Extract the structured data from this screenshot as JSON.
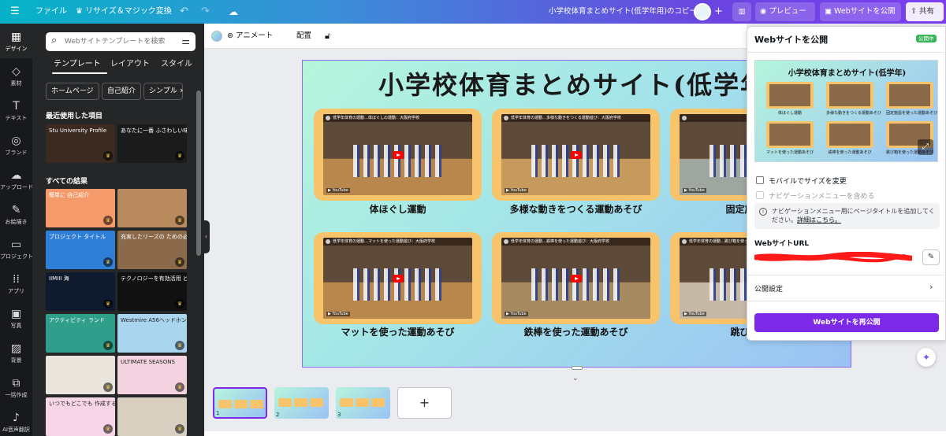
{
  "topbar": {
    "menu_icon": "hamburger-icon",
    "file": "ファイル",
    "resize": "リサイズ＆マジック変換",
    "resize_icon": "crown-icon",
    "undo_icon": "undo-icon",
    "redo_icon": "redo-icon",
    "cloud_icon": "cloud-check-icon",
    "doc_title": "小学校体育まとめサイト(低学年用)のコピー",
    "preview": "プレビュー",
    "publish_website": "Webサイトを公開",
    "share": "共有"
  },
  "rail": {
    "items": [
      {
        "label": "デザイン",
        "icon": "design-icon"
      },
      {
        "label": "素材",
        "icon": "elements-icon"
      },
      {
        "label": "テキスト",
        "icon": "text-icon"
      },
      {
        "label": "ブランド",
        "icon": "brand-icon"
      },
      {
        "label": "アップロード",
        "icon": "upload-icon"
      },
      {
        "label": "お絵描き",
        "icon": "draw-icon"
      },
      {
        "label": "プロジェクト",
        "icon": "folder-icon"
      },
      {
        "label": "アプリ",
        "icon": "apps-icon"
      },
      {
        "label": "写真",
        "icon": "photo-icon"
      },
      {
        "label": "背景",
        "icon": "background-icon"
      },
      {
        "label": "一括作成",
        "icon": "bulk-create-icon"
      },
      {
        "label": "AI音声翻訳",
        "icon": "ai-voice-icon"
      }
    ]
  },
  "panel": {
    "search_placeholder": "Webサイトテンプレートを検索",
    "tabs": [
      "テンプレート",
      "レイアウト",
      "スタイル"
    ],
    "chips": [
      "ホームページ",
      "自己紹介",
      "シンプル"
    ],
    "recent_heading": "最近使用した項目",
    "all_heading": "すべての結果",
    "recent": [
      {
        "text": "Stu University Profile",
        "color": "#3a2a20"
      },
      {
        "text": "あなたに一番 ふさわしい味",
        "color": "#1b1b1b"
      }
    ],
    "results": [
      {
        "text": "簡単に 自己紹介",
        "color": "#f59a6a"
      },
      {
        "text": "",
        "color": "#b98a5e"
      },
      {
        "text": "プロジェクト タイトル",
        "color": "#2f7fd6"
      },
      {
        "text": "充実したリーズの ための必需品",
        "color": "#8a6a4a"
      },
      {
        "text": "IIMIII 海",
        "color": "#0f1a2e"
      },
      {
        "text": "テクノロジーを有効活用 どのように使うを伝えます",
        "color": "#111"
      },
      {
        "text": "アクティビティ ランド",
        "color": "#2f9e8a"
      },
      {
        "text": "Westmire A56ヘッドホン",
        "color": "#a9d6ee"
      },
      {
        "text": "",
        "color": "#e9e4dc"
      },
      {
        "text": "ULTIMATE SEASONS",
        "color": "#f3d3e0"
      },
      {
        "text": "いつでもどこでも 作成する",
        "color": "#f7d5e6"
      },
      {
        "text": "",
        "color": "#d9cfc0"
      }
    ]
  },
  "toolbar2": {
    "animate": "アニメート",
    "position": "配置",
    "lock_icon": "lock-icon"
  },
  "page": {
    "title": "小学校体育まとめサイト(低学年",
    "cards": [
      {
        "caption": "体ほぐし運動",
        "video_title": "低学年体育の運動…体ほぐしの運動：大阪府学校",
        "color_floor": "#b8874e"
      },
      {
        "caption": "多様な動きをつくる運動あそび",
        "video_title": "低学年体育の運動…多様な動きをつくる運動遊び：大阪府学校",
        "color_floor": "#c59a5c"
      },
      {
        "caption": "固定施設を使",
        "video_title": "",
        "color_floor": "#9fa6a0"
      },
      {
        "caption": "マットを使った運動あそび",
        "video_title": "低学年体育の運動…マットを使った運動遊び：大阪府学校",
        "color_floor": "#b8874e"
      },
      {
        "caption": "鉄棒を使った運動あそび",
        "video_title": "低学年体育の運動…鉄棒を使った運動遊び：大阪府学校",
        "color_floor": "#a58a62"
      },
      {
        "caption": "跳び箱を使",
        "video_title": "低学年体育の運動…跳び箱を使った運動遊び",
        "color_floor": "#c7b9a8"
      }
    ]
  },
  "strip": {
    "pages": [
      "1",
      "2",
      "3"
    ],
    "add_icon": "plus-icon"
  },
  "publish": {
    "title": "Webサイトを公開",
    "badge": "公開中",
    "preview_title": "小学校体育まとめサイト(低学年)",
    "preview_labels": [
      "体ほぐし運動",
      "多様な動きをつくる運動あそび",
      "固定施設を使った運動あそび",
      "マットを使った運動あそび",
      "鉄棒を使った運動あそび",
      "跳び箱を使った運動あそび"
    ],
    "resize_mobile": "モバイルでサイズを変更",
    "nav_menu": "ナビゲーションメニューを含める",
    "info_text": "ナビゲーションメニュー用にページタイトルを追加してください。",
    "info_link": "詳細はこちら。",
    "url_label": "WebサイトURL",
    "url_redacted_color": "#ff1a1a",
    "settings": "公開設定",
    "republish": "Webサイトを再公開"
  },
  "accent": "#7d2ae8"
}
